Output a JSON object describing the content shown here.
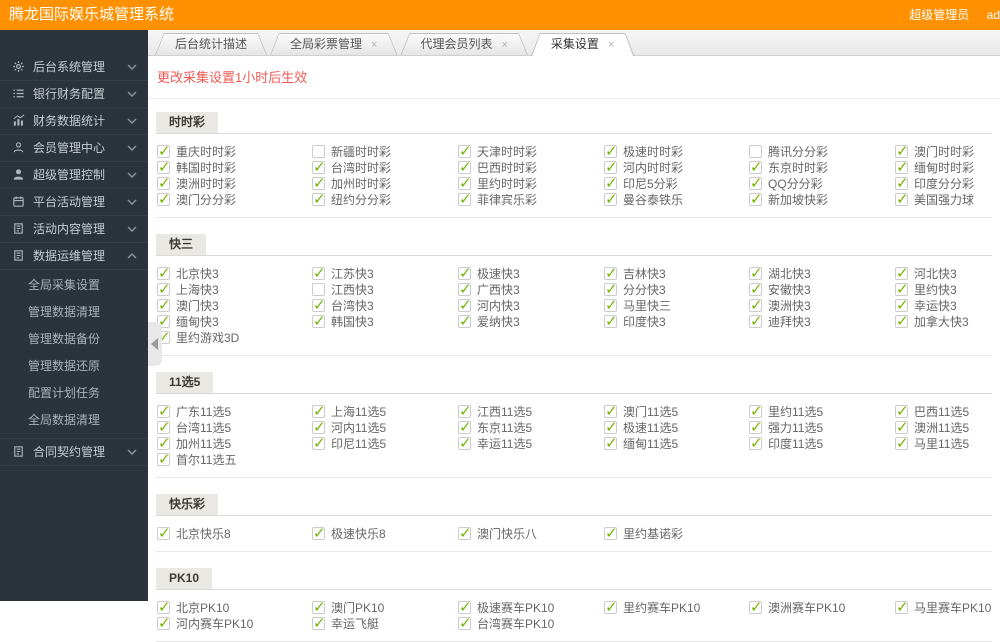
{
  "topbar": {
    "title": "腾龙国际娱乐城管理系统",
    "role": "超级管理员",
    "user": "ad"
  },
  "sidebar": {
    "items": [
      {
        "label": "后台系统管理",
        "icon": "gear-icon"
      },
      {
        "label": "银行财务配置",
        "icon": "bank-list-icon"
      },
      {
        "label": "财务数据统计",
        "icon": "chart-icon"
      },
      {
        "label": "会员管理中心",
        "icon": "member-icon"
      },
      {
        "label": "超级管理控制",
        "icon": "admin-icon"
      },
      {
        "label": "平台活动管理",
        "icon": "calendar-icon"
      },
      {
        "label": "活动内容管理",
        "icon": "doc-icon"
      },
      {
        "label": "数据运维管理",
        "icon": "doc-icon",
        "expanded": true,
        "children": [
          "全局采集设置",
          "管理数据清理",
          "管理数据备份",
          "管理数据还原",
          "配置计划任务",
          "全局数据清理"
        ]
      },
      {
        "label": "合同契约管理",
        "icon": "doc-icon"
      }
    ]
  },
  "tabs": [
    {
      "label": "后台统计描述",
      "closable": false,
      "active": false
    },
    {
      "label": "全局彩票管理",
      "closable": true,
      "active": false
    },
    {
      "label": "代理会员列表",
      "closable": true,
      "active": false
    },
    {
      "label": "采集设置",
      "closable": true,
      "active": true
    }
  ],
  "notice": "更改采集设置1小时后生效",
  "sections": [
    {
      "title": "时时彩",
      "items": [
        {
          "name": "重庆时时彩",
          "checked": true
        },
        {
          "name": "新疆时时彩",
          "checked": false
        },
        {
          "name": "天津时时彩",
          "checked": true
        },
        {
          "name": "极速时时彩",
          "checked": true
        },
        {
          "name": "腾讯分分彩",
          "checked": false
        },
        {
          "name": "澳门时时彩",
          "checked": true
        },
        {
          "name": "韩国时时彩",
          "checked": true
        },
        {
          "name": "台湾时时彩",
          "checked": true
        },
        {
          "name": "巴西时时彩",
          "checked": true
        },
        {
          "name": "河内时时彩",
          "checked": true
        },
        {
          "name": "东京时时彩",
          "checked": true
        },
        {
          "name": "缅甸时时彩",
          "checked": true
        },
        {
          "name": "澳洲时时彩",
          "checked": true
        },
        {
          "name": "加州时时彩",
          "checked": true
        },
        {
          "name": "里约时时彩",
          "checked": true
        },
        {
          "name": "印尼5分彩",
          "checked": true
        },
        {
          "name": "QQ分分彩",
          "checked": true
        },
        {
          "name": "印度分分彩",
          "checked": true
        },
        {
          "name": "澳门分分彩",
          "checked": true
        },
        {
          "name": "纽约分分彩",
          "checked": true
        },
        {
          "name": "菲律宾乐彩",
          "checked": true
        },
        {
          "name": "曼谷泰铁乐",
          "checked": true
        },
        {
          "name": "新加坡快彩",
          "checked": true
        },
        {
          "name": "美国强力球",
          "checked": true
        }
      ]
    },
    {
      "title": "快三",
      "items": [
        {
          "name": "北京快3",
          "checked": true
        },
        {
          "name": "江苏快3",
          "checked": true
        },
        {
          "name": "极速快3",
          "checked": true
        },
        {
          "name": "吉林快3",
          "checked": true
        },
        {
          "name": "湖北快3",
          "checked": true
        },
        {
          "name": "河北快3",
          "checked": true
        },
        {
          "name": "上海快3",
          "checked": true
        },
        {
          "name": "江西快3",
          "checked": false
        },
        {
          "name": "广西快3",
          "checked": true
        },
        {
          "name": "分分快3",
          "checked": true
        },
        {
          "name": "安徽快3",
          "checked": true
        },
        {
          "name": "里约快3",
          "checked": true
        },
        {
          "name": "澳门快3",
          "checked": true
        },
        {
          "name": "台湾快3",
          "checked": true
        },
        {
          "name": "河内快3",
          "checked": true
        },
        {
          "name": "马里快三",
          "checked": true
        },
        {
          "name": "澳洲快3",
          "checked": true
        },
        {
          "name": "幸运快3",
          "checked": true
        },
        {
          "name": "缅甸快3",
          "checked": true
        },
        {
          "name": "韩国快3",
          "checked": true
        },
        {
          "name": "爱纳快3",
          "checked": true
        },
        {
          "name": "印度快3",
          "checked": true
        },
        {
          "name": "迪拜快3",
          "checked": true
        },
        {
          "name": "加拿大快3",
          "checked": true
        },
        {
          "name": "里约游戏3D",
          "checked": true
        }
      ]
    },
    {
      "title": "11选5",
      "items": [
        {
          "name": "广东11选5",
          "checked": true
        },
        {
          "name": "上海11选5",
          "checked": true
        },
        {
          "name": "江西11选5",
          "checked": true
        },
        {
          "name": "澳门11选5",
          "checked": true
        },
        {
          "name": "里约11选5",
          "checked": true
        },
        {
          "name": "巴西11选5",
          "checked": true
        },
        {
          "name": "台湾11选5",
          "checked": true
        },
        {
          "name": "河内11选5",
          "checked": true
        },
        {
          "name": "东京11选5",
          "checked": true
        },
        {
          "name": "极速11选5",
          "checked": true
        },
        {
          "name": "强力11选5",
          "checked": true
        },
        {
          "name": "澳洲11选5",
          "checked": true
        },
        {
          "name": "加州11选5",
          "checked": true
        },
        {
          "name": "印尼11选5",
          "checked": true
        },
        {
          "name": "幸运11选5",
          "checked": true
        },
        {
          "name": "缅甸11选5",
          "checked": true
        },
        {
          "name": "印度11选5",
          "checked": true
        },
        {
          "name": "马里11选5",
          "checked": true
        },
        {
          "name": "首尔11选五",
          "checked": true
        }
      ]
    },
    {
      "title": "快乐彩",
      "items": [
        {
          "name": "北京快乐8",
          "checked": true
        },
        {
          "name": "极速快乐8",
          "checked": true
        },
        {
          "name": "澳门快乐八",
          "checked": true
        },
        {
          "name": "里约基诺彩",
          "checked": true
        }
      ]
    },
    {
      "title": "PK10",
      "items": [
        {
          "name": "北京PK10",
          "checked": true
        },
        {
          "name": "澳门PK10",
          "checked": true
        },
        {
          "name": "极速赛车PK10",
          "checked": true
        },
        {
          "name": "里约赛车PK10",
          "checked": true
        },
        {
          "name": "澳洲赛车PK10",
          "checked": true
        },
        {
          "name": "马里赛车PK10",
          "checked": true
        },
        {
          "name": "河内赛车PK10",
          "checked": true
        },
        {
          "name": "幸运飞艇",
          "checked": true
        },
        {
          "name": "台湾赛车PK10",
          "checked": true
        }
      ]
    }
  ],
  "colors": {
    "topbar_bg": "#ff9000",
    "sidebar_bg": "#2b343c",
    "check_green": "#76b406",
    "notice_red": "#ee5a54",
    "section_header_bg": "#e9e8e3"
  }
}
